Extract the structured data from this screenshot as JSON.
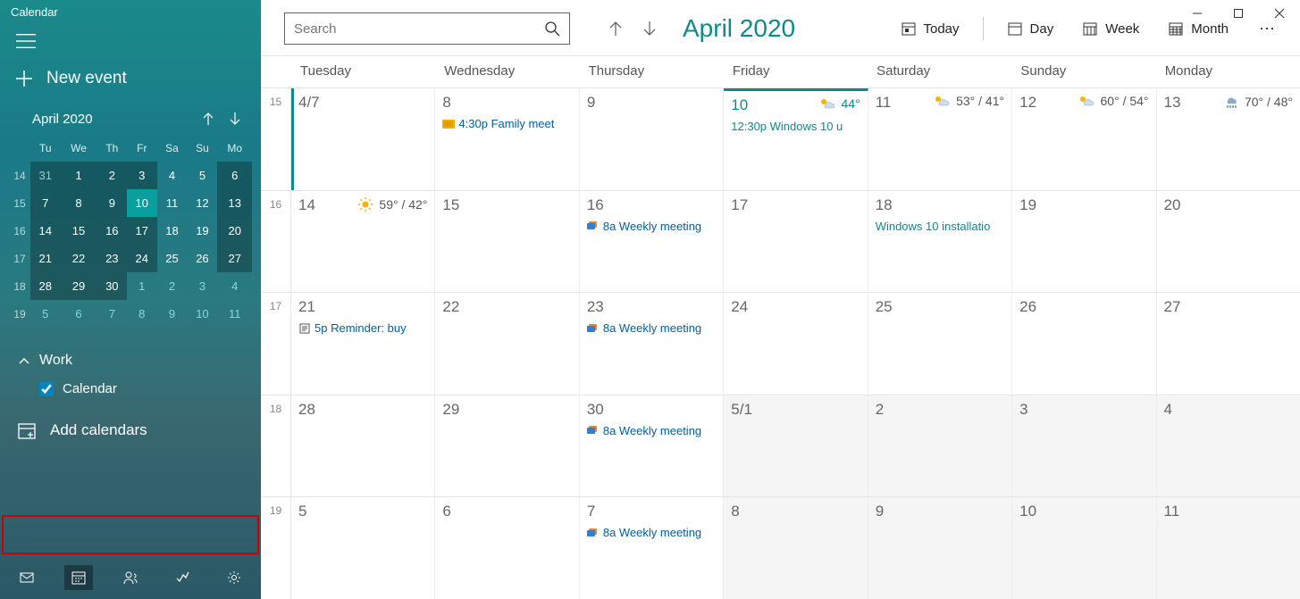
{
  "app_title": "Calendar",
  "new_event_label": "New event",
  "mini_calendar": {
    "title": "April 2020",
    "weekdays": [
      "Tu",
      "We",
      "Th",
      "Fr",
      "Sa",
      "Su",
      "Mo"
    ],
    "rows": [
      {
        "wk": "14",
        "days": [
          {
            "n": "31",
            "cls": "other shade"
          },
          {
            "n": "1",
            "cls": "shade currmonth"
          },
          {
            "n": "2",
            "cls": "shade currmonth"
          },
          {
            "n": "3",
            "cls": "shade currmonth"
          },
          {
            "n": "4",
            "cls": "currmonth"
          },
          {
            "n": "5",
            "cls": "currmonth"
          },
          {
            "n": "6",
            "cls": "shade currmonth"
          }
        ]
      },
      {
        "wk": "15",
        "days": [
          {
            "n": "7",
            "cls": "shade currmonth"
          },
          {
            "n": "8",
            "cls": "shade currmonth"
          },
          {
            "n": "9",
            "cls": "shade currmonth"
          },
          {
            "n": "10",
            "cls": "today currmonth"
          },
          {
            "n": "11",
            "cls": "currmonth"
          },
          {
            "n": "12",
            "cls": "currmonth"
          },
          {
            "n": "13",
            "cls": "shade currmonth"
          }
        ]
      },
      {
        "wk": "16",
        "days": [
          {
            "n": "14",
            "cls": "shade currmonth"
          },
          {
            "n": "15",
            "cls": "shade currmonth"
          },
          {
            "n": "16",
            "cls": "shade currmonth"
          },
          {
            "n": "17",
            "cls": "shade currmonth"
          },
          {
            "n": "18",
            "cls": "currmonth"
          },
          {
            "n": "19",
            "cls": "currmonth"
          },
          {
            "n": "20",
            "cls": "shade currmonth"
          }
        ]
      },
      {
        "wk": "17",
        "days": [
          {
            "n": "21",
            "cls": "shade currmonth"
          },
          {
            "n": "22",
            "cls": "shade currmonth"
          },
          {
            "n": "23",
            "cls": "shade currmonth"
          },
          {
            "n": "24",
            "cls": "shade currmonth"
          },
          {
            "n": "25",
            "cls": "currmonth"
          },
          {
            "n": "26",
            "cls": "currmonth"
          },
          {
            "n": "27",
            "cls": "shade currmonth"
          }
        ]
      },
      {
        "wk": "18",
        "days": [
          {
            "n": "28",
            "cls": "shade currmonth"
          },
          {
            "n": "29",
            "cls": "shade currmonth"
          },
          {
            "n": "30",
            "cls": "shade currmonth"
          },
          {
            "n": "1",
            "cls": "nextmonth"
          },
          {
            "n": "2",
            "cls": "nextmonth"
          },
          {
            "n": "3",
            "cls": "nextmonth"
          },
          {
            "n": "4",
            "cls": "nextmonth"
          }
        ]
      },
      {
        "wk": "19",
        "days": [
          {
            "n": "5",
            "cls": "nextmonth"
          },
          {
            "n": "6",
            "cls": "nextmonth"
          },
          {
            "n": "7",
            "cls": "nextmonth"
          },
          {
            "n": "8",
            "cls": "nextmonth"
          },
          {
            "n": "9",
            "cls": "nextmonth"
          },
          {
            "n": "10",
            "cls": "nextmonth"
          },
          {
            "n": "11",
            "cls": "nextmonth"
          }
        ]
      }
    ]
  },
  "account": {
    "name": "Work",
    "calendar_label": "Calendar"
  },
  "add_calendars_label": "Add calendars",
  "search_placeholder": "Search",
  "header_month": "April 2020",
  "toolbar": {
    "today": "Today",
    "day": "Day",
    "week": "Week",
    "month": "Month"
  },
  "day_headers": [
    "Tuesday",
    "Wednesday",
    "Thursday",
    "Friday",
    "Saturday",
    "Sunday",
    "Monday"
  ],
  "weeks": [
    {
      "wk": "15",
      "days": [
        {
          "date": "4/7"
        },
        {
          "date": "8",
          "events": [
            {
              "type": "holiday",
              "text": "4:30p Family meet"
            }
          ]
        },
        {
          "date": "9"
        },
        {
          "date": "10",
          "today": true,
          "weather": {
            "icon": "partly",
            "temp": "44°"
          },
          "events": [
            {
              "type": "teal",
              "text": "12:30p  Windows 10 u"
            }
          ]
        },
        {
          "date": "11",
          "weather": {
            "icon": "partly",
            "temp": "53° / 41°"
          }
        },
        {
          "date": "12",
          "weather": {
            "icon": "partly",
            "temp": "60° / 54°"
          }
        },
        {
          "date": "13",
          "weather": {
            "icon": "rain",
            "temp": "70° / 48°"
          }
        }
      ]
    },
    {
      "wk": "16",
      "days": [
        {
          "date": "14",
          "weather": {
            "icon": "sun",
            "temp": "59° / 42°"
          }
        },
        {
          "date": "15"
        },
        {
          "date": "16",
          "events": [
            {
              "type": "meeting",
              "text": "8a Weekly meeting"
            }
          ]
        },
        {
          "date": "17"
        },
        {
          "date": "18",
          "events": [
            {
              "type": "teal",
              "text": "Windows 10 installatio"
            }
          ]
        },
        {
          "date": "19"
        },
        {
          "date": "20"
        }
      ]
    },
    {
      "wk": "17",
      "days": [
        {
          "date": "21",
          "events": [
            {
              "type": "note",
              "text": "5p Reminder: buy"
            }
          ]
        },
        {
          "date": "22"
        },
        {
          "date": "23",
          "events": [
            {
              "type": "meeting",
              "text": "8a Weekly meeting"
            }
          ]
        },
        {
          "date": "24"
        },
        {
          "date": "25"
        },
        {
          "date": "26"
        },
        {
          "date": "27"
        }
      ]
    },
    {
      "wk": "18",
      "days": [
        {
          "date": "28"
        },
        {
          "date": "29"
        },
        {
          "date": "30",
          "events": [
            {
              "type": "meeting",
              "text": "8a Weekly meeting"
            }
          ]
        },
        {
          "date": "5/1",
          "next": true
        },
        {
          "date": "2",
          "next": true
        },
        {
          "date": "3",
          "next": true
        },
        {
          "date": "4",
          "next": true
        }
      ]
    },
    {
      "wk": "19",
      "days": [
        {
          "date": "5",
          "next": true
        },
        {
          "date": "6",
          "next": true
        },
        {
          "date": "7",
          "next": true,
          "events": [
            {
              "type": "meeting",
              "text": "8a Weekly meeting"
            }
          ]
        },
        {
          "date": "8",
          "next": true
        },
        {
          "date": "9",
          "next": true
        },
        {
          "date": "10",
          "next": true
        },
        {
          "date": "11",
          "next": true
        }
      ]
    }
  ]
}
